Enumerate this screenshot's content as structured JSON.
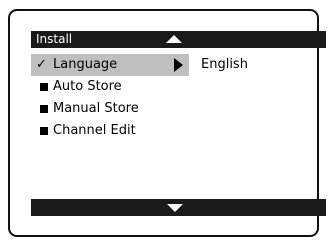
{
  "menu": {
    "title": "Install",
    "items": [
      {
        "label": "Language",
        "marker": "✓",
        "selected": true
      },
      {
        "label": "Auto Store"
      },
      {
        "label": "Manual Store"
      },
      {
        "label": "Channel Edit"
      }
    ],
    "selected_value": "English"
  },
  "icons": {
    "scroll_up": "triangle-up-icon",
    "scroll_down": "triangle-down-icon",
    "submenu": "triangle-right-icon"
  },
  "colors": {
    "header": "#1a1a1a",
    "selection": "#bfbfbf",
    "text": "#000000"
  }
}
